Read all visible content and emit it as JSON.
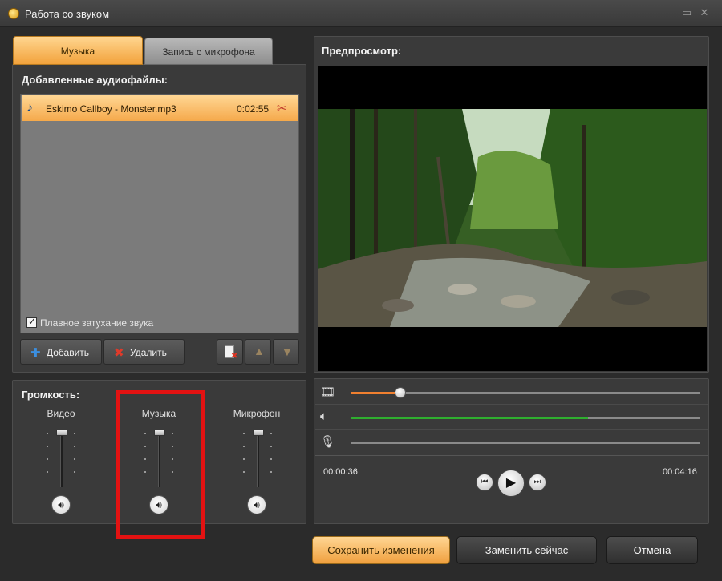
{
  "window": {
    "title": "Работа со звуком"
  },
  "tabs": [
    {
      "label": "Музыка",
      "active": true
    },
    {
      "label": "Запись с микрофона",
      "active": false
    }
  ],
  "audio_list": {
    "heading": "Добавленные аудиофайлы:",
    "items": [
      {
        "name": "Eskimo Callboy - Monster.mp3",
        "duration": "0:02:55"
      }
    ],
    "fade_checkbox": {
      "label": "Плавное затухание звука",
      "checked": true
    }
  },
  "list_buttons": {
    "add": "Добавить",
    "delete": "Удалить"
  },
  "volume": {
    "heading": "Громкость:",
    "channels": [
      {
        "label": "Видео"
      },
      {
        "label": "Музыка"
      },
      {
        "label": "Микрофон"
      }
    ]
  },
  "preview": {
    "heading": "Предпросмотр:",
    "time_current": "00:00:36",
    "time_total": "00:04:16",
    "video_position": 0.14,
    "music_track_level": 0.68
  },
  "footer": {
    "save": "Сохранить изменения",
    "replace": "Заменить сейчас",
    "cancel": "Отмена"
  },
  "colors": {
    "accent_orange": "#f5a94b",
    "highlight_red": "#e31212",
    "music_green": "#2fae2f",
    "position_orange": "#f08030"
  }
}
